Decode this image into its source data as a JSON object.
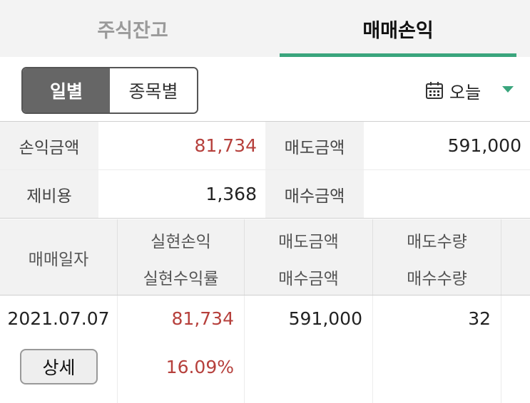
{
  "tabs": [
    {
      "label": "주식잔고"
    },
    {
      "label": "매매손익"
    }
  ],
  "period_toggle": {
    "daily": "일별",
    "by_stock": "종목별"
  },
  "date_filter": {
    "label": "오늘",
    "icon": "calendar-icon"
  },
  "summary": {
    "profit_label": "손익금액",
    "profit_value": "81,734",
    "sell_amount_label": "매도금액",
    "sell_amount_value": "591,000",
    "fees_label": "제비용",
    "fees_value": "1,368",
    "buy_amount_label": "매수금액",
    "buy_amount_value": ""
  },
  "table": {
    "headers": {
      "date": "매매일자",
      "realized_profit": "실현손익",
      "realized_rate": "실현수익률",
      "sell_amount": "매도금액",
      "buy_amount": "매수금액",
      "sell_qty": "매도수량",
      "buy_qty": "매수수량"
    },
    "rows": [
      {
        "date": "2021.07.07",
        "detail_button": "상세",
        "realized_profit": "81,734",
        "realized_rate": "16.09%",
        "sell_amount": "591,000",
        "buy_amount": "",
        "sell_qty": "32",
        "buy_qty": ""
      }
    ]
  },
  "colors": {
    "accent": "#3aa57d",
    "profit": "#b6403c",
    "toggle_active": "#666666"
  }
}
